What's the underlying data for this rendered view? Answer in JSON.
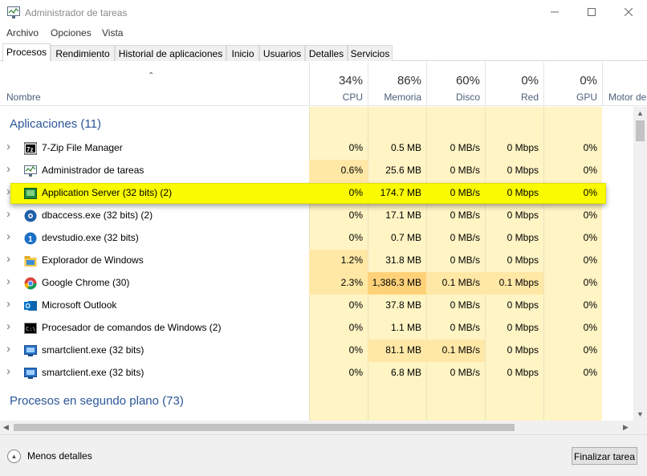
{
  "window": {
    "title": "Administrador de tareas"
  },
  "menu": [
    "Archivo",
    "Opciones",
    "Vista"
  ],
  "tabs": [
    "Procesos",
    "Rendimiento",
    "Historial de aplicaciones",
    "Inicio",
    "Usuarios",
    "Detalles",
    "Servicios"
  ],
  "active_tab": "Procesos",
  "columns": {
    "name": "Nombre",
    "cpu": {
      "pct": "34%",
      "label": "CPU"
    },
    "mem": {
      "pct": "86%",
      "label": "Memoria"
    },
    "disk": {
      "pct": "60%",
      "label": "Disco"
    },
    "net": {
      "pct": "0%",
      "label": "Red"
    },
    "gpu": {
      "pct": "0%",
      "label": "GPU"
    },
    "engine": {
      "label": "Motor de"
    }
  },
  "groups": {
    "apps": "Aplicaciones (11)",
    "background": "Procesos en segundo plano (73)"
  },
  "rows": [
    {
      "icon": "7zip-icon",
      "name": "7-Zip File Manager",
      "cpu": "0%",
      "mem": "0.5 MB",
      "disk": "0 MB/s",
      "net": "0 Mbps",
      "gpu": "0%"
    },
    {
      "icon": "task-manager-icon",
      "name": "Administrador de tareas",
      "cpu": "0.6%",
      "mem": "25.6 MB",
      "disk": "0 MB/s",
      "net": "0 Mbps",
      "gpu": "0%"
    },
    {
      "icon": "app-server-icon",
      "name": "Application Server (32 bits) (2)",
      "cpu": "0%",
      "mem": "174.7 MB",
      "disk": "0 MB/s",
      "net": "0 Mbps",
      "gpu": "0%",
      "highlighted": true
    },
    {
      "icon": "dbaccess-icon",
      "name": "dbaccess.exe (32 bits) (2)",
      "cpu": "0%",
      "mem": "17.1 MB",
      "disk": "0 MB/s",
      "net": "0 Mbps",
      "gpu": "0%"
    },
    {
      "icon": "devstudio-icon",
      "name": "devstudio.exe (32 bits)",
      "cpu": "0%",
      "mem": "0.7 MB",
      "disk": "0 MB/s",
      "net": "0 Mbps",
      "gpu": "0%"
    },
    {
      "icon": "explorer-icon",
      "name": "Explorador de Windows",
      "cpu": "1.2%",
      "mem": "31.8 MB",
      "disk": "0 MB/s",
      "net": "0 Mbps",
      "gpu": "0%"
    },
    {
      "icon": "chrome-icon",
      "name": "Google Chrome (30)",
      "cpu": "2.3%",
      "mem": "1,386.3 MB",
      "disk": "0.1 MB/s",
      "net": "0.1 Mbps",
      "gpu": "0%"
    },
    {
      "icon": "outlook-icon",
      "name": "Microsoft Outlook",
      "cpu": "0%",
      "mem": "37.8 MB",
      "disk": "0 MB/s",
      "net": "0 Mbps",
      "gpu": "0%"
    },
    {
      "icon": "cmd-icon",
      "name": "Procesador de comandos de Windows (2)",
      "cpu": "0%",
      "mem": "1.1 MB",
      "disk": "0 MB/s",
      "net": "0 Mbps",
      "gpu": "0%"
    },
    {
      "icon": "smartclient-icon",
      "name": "smartclient.exe (32 bits)",
      "cpu": "0%",
      "mem": "81.1 MB",
      "disk": "0.1 MB/s",
      "net": "0 Mbps",
      "gpu": "0%"
    },
    {
      "icon": "smartclient-icon",
      "name": "smartclient.exe (32 bits)",
      "cpu": "0%",
      "mem": "6.8 MB",
      "disk": "0 MB/s",
      "net": "0 Mbps",
      "gpu": "0%"
    }
  ],
  "footer": {
    "less_details": "Menos detalles",
    "end_task": "Finalizar tarea"
  },
  "colors": {
    "heat_light": "#fff4c4",
    "heat_mid": "#ffe8a6",
    "heat_high": "#ffd27a",
    "highlight": "#fafa00",
    "group_text": "#2b5797"
  }
}
